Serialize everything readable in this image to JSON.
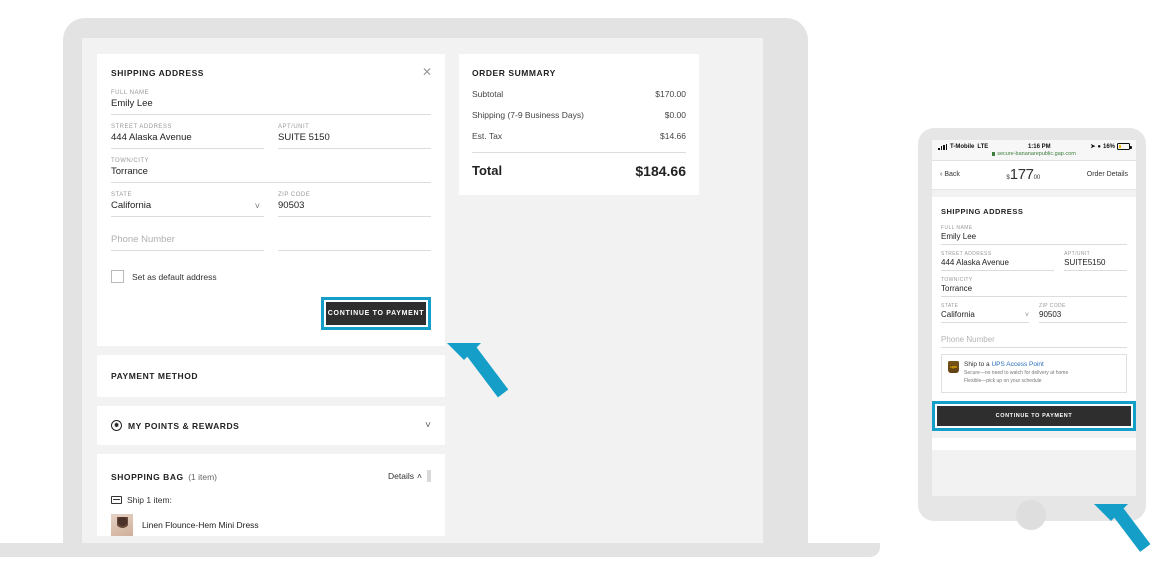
{
  "desktop": {
    "shipping": {
      "title": "SHIPPING ADDRESS",
      "close_icon": "close-icon",
      "fields": [
        {
          "label": "FULL NAME",
          "value": "Emily Lee"
        },
        {
          "label": "STREET ADDRESS",
          "value": "444 Alaska Avenue"
        },
        {
          "label": "APT/UNIT",
          "value": "SUITE 5150"
        },
        {
          "label": "TOWN/CITY",
          "value": "Torrance"
        },
        {
          "label": "STATE",
          "value": "California"
        },
        {
          "label": "ZIP CODE",
          "value": "90503"
        }
      ],
      "phone_placeholder": "Phone Number",
      "default_checkbox_label": "Set as default address",
      "continue_button": "CONTINUE TO PAYMENT"
    },
    "payment_method_title": "PAYMENT METHOD",
    "rewards_title": "MY POINTS & REWARDS",
    "bag": {
      "title": "SHOPPING BAG",
      "count": "(1 item)",
      "details_label": "Details",
      "ship_line": "Ship 1 item:",
      "product_name": "Linen Flounce-Hem Mini Dress"
    },
    "order_summary": {
      "title": "ORDER SUMMARY",
      "rows": [
        {
          "label": "Subtotal",
          "value": "$170.00"
        },
        {
          "label": "Shipping (7-9 Business Days)",
          "value": "$0.00"
        },
        {
          "label": "Est. Tax",
          "value": "$14.66"
        }
      ],
      "total_label": "Total",
      "total_value": "$184.66"
    }
  },
  "phone": {
    "status": {
      "carrier": "T-Mobile",
      "network": "LTE",
      "time": "1:16 PM",
      "battery": "16%"
    },
    "url": "secure-bananarepublic.gap.com",
    "nav": {
      "back": "Back",
      "currency": "$",
      "price_whole": "177",
      "price_cents": "00",
      "order_details": "Order Details"
    },
    "shipping": {
      "title": "SHIPPING ADDRESS",
      "fields": [
        {
          "label": "FULL NAME",
          "value": "Emily Lee"
        },
        {
          "label": "STREET ADDRESS",
          "value": "444 Alaska Avenue"
        },
        {
          "label": "APT/UNIT",
          "value": "SUITE5150"
        },
        {
          "label": "TOWN/CITY",
          "value": "Torrance"
        },
        {
          "label": "STATE",
          "value": "California"
        },
        {
          "label": "ZIP CODE",
          "value": "90503"
        }
      ],
      "phone_placeholder": "Phone Number"
    },
    "ups": {
      "lead": "Ship to a ",
      "link": "UPS Access Point",
      "line1": "Secure—no need to watch for delivery at home",
      "line2": "Flexible—pick up on your schedule"
    },
    "continue_button": "CONTINUE TO PAYMENT"
  },
  "colors": {
    "highlight": "#149ec8",
    "button_dark": "#2e2e2e",
    "device": "#e3e3e3",
    "screen_bg": "#f2f2f2"
  }
}
